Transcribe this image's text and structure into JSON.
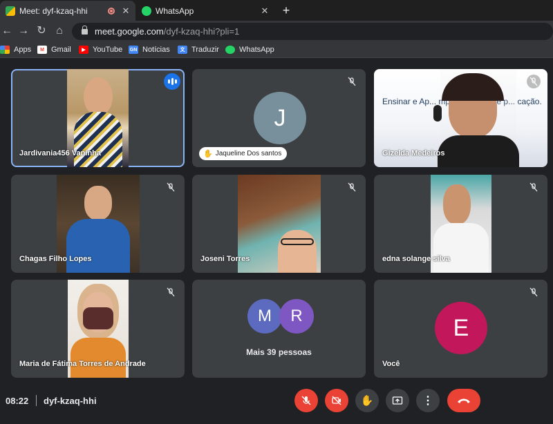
{
  "browser": {
    "tabs": [
      {
        "title": "Meet: dyf-kzaq-hhi",
        "recording": true
      },
      {
        "title": "WhatsApp"
      }
    ],
    "url_host": "meet.google.com",
    "url_path": "/dyf-kzaq-hhi?pli=1",
    "bookmarks": [
      {
        "label": "Apps",
        "icon": "apps-grid-icon"
      },
      {
        "label": "Gmail",
        "icon": "gmail-icon"
      },
      {
        "label": "YouTube",
        "icon": "youtube-icon"
      },
      {
        "label": "Notícias",
        "icon": "news-icon"
      },
      {
        "label": "Traduzir",
        "icon": "translate-icon"
      },
      {
        "label": "WhatsApp",
        "icon": "whatsapp-icon"
      }
    ]
  },
  "meeting": {
    "participants": [
      {
        "name": "Jardivania456 Vaninha",
        "speaking": true
      },
      {
        "name": "Jaqueline Dos santos",
        "initial": "J",
        "avatar_color": "#78909c",
        "hand_raised": true,
        "muted": true
      },
      {
        "name": "Gizelda Medeiros",
        "muted": true,
        "slide_text": "Ensinar e Ap... mpos, desafios e p... cação."
      },
      {
        "name": "Chagas Filho Lopes",
        "muted": true
      },
      {
        "name": "Joseni Torres",
        "muted": true
      },
      {
        "name": "edna solange silva",
        "muted": true
      },
      {
        "name": "Maria de Fátima Torres de Andrade",
        "muted": true
      },
      {
        "name": "Mais 39 pessoas",
        "initials": [
          "M",
          "R"
        ],
        "avatar_colors": [
          "#5c6bc0",
          "#7e57c2"
        ]
      },
      {
        "name": "Você",
        "initial": "E",
        "avatar_color": "#c2185b",
        "muted": true
      }
    ],
    "time": "08:22",
    "code": "dyf-kzaq-hhi"
  },
  "controls": [
    "mic-off-icon",
    "camera-off-icon",
    "raise-hand-icon",
    "present-screen-icon",
    "more-options-icon",
    "end-call-icon"
  ],
  "colors": {
    "red": "#ea4335",
    "speaking_blue": "#1a73e8",
    "tile_bg": "#3c4043"
  }
}
